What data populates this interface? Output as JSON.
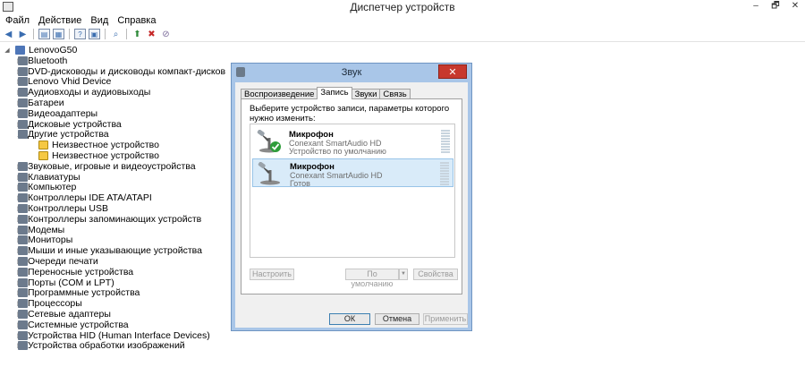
{
  "window": {
    "title": "Диспетчер устройств",
    "controls": [
      "–",
      "🗗",
      "✕"
    ]
  },
  "menu": [
    "Файл",
    "Действие",
    "Вид",
    "Справка"
  ],
  "toolbar_icons": [
    "back-icon",
    "forward-icon",
    "properties-icon",
    "help-icon",
    "scan-hardware-icon",
    "update-driver-icon",
    "uninstall-icon",
    "disable-icon"
  ],
  "tree": {
    "root": "LenovoG50",
    "items": [
      {
        "label": "Bluetooth",
        "level": 1,
        "expander": "▷"
      },
      {
        "label": "DVD-дисководы и дисководы компакт-дисков",
        "level": 1,
        "expander": "▷"
      },
      {
        "label": "Lenovo Vhid Device",
        "level": 1,
        "expander": "▷"
      },
      {
        "label": "Аудиовходы и аудиовыходы",
        "level": 1,
        "expander": "▷"
      },
      {
        "label": "Батареи",
        "level": 1,
        "expander": "▷"
      },
      {
        "label": "Видеоадаптеры",
        "level": 1,
        "expander": "▷"
      },
      {
        "label": "Дисковые устройства",
        "level": 1,
        "expander": "▷"
      },
      {
        "label": "Другие устройства",
        "level": 1,
        "expander": "◢"
      },
      {
        "label": "Неизвестное устройство",
        "level": 2,
        "expander": ""
      },
      {
        "label": "Неизвестное устройство",
        "level": 2,
        "expander": ""
      },
      {
        "label": "Звуковые, игровые и видеоустройства",
        "level": 1,
        "expander": "▷"
      },
      {
        "label": "Клавиатуры",
        "level": 1,
        "expander": "▷"
      },
      {
        "label": "Компьютер",
        "level": 1,
        "expander": "▷"
      },
      {
        "label": "Контроллеры IDE ATA/ATAPI",
        "level": 1,
        "expander": "▷"
      },
      {
        "label": "Контроллеры USB",
        "level": 1,
        "expander": "▷"
      },
      {
        "label": "Контроллеры запоминающих устройств",
        "level": 1,
        "expander": "▷"
      },
      {
        "label": "Модемы",
        "level": 1,
        "expander": "▷"
      },
      {
        "label": "Мониторы",
        "level": 1,
        "expander": "▷"
      },
      {
        "label": "Мыши и иные указывающие устройства",
        "level": 1,
        "expander": "▷"
      },
      {
        "label": "Очереди печати",
        "level": 1,
        "expander": "▷"
      },
      {
        "label": "Переносные устройства",
        "level": 1,
        "expander": "▷"
      },
      {
        "label": "Порты (COM и LPT)",
        "level": 1,
        "expander": "▷"
      },
      {
        "label": "Программные устройства",
        "level": 1,
        "expander": "▷"
      },
      {
        "label": "Процессоры",
        "level": 1,
        "expander": "▷"
      },
      {
        "label": "Сетевые адаптеры",
        "level": 1,
        "expander": "▷"
      },
      {
        "label": "Системные устройства",
        "level": 1,
        "expander": "▷"
      },
      {
        "label": "Устройства HID (Human Interface Devices)",
        "level": 1,
        "expander": "▷"
      },
      {
        "label": "Устройства обработки изображений",
        "level": 1,
        "expander": "▷"
      }
    ]
  },
  "dialog": {
    "title": "Звук",
    "close": "✕",
    "tabs": [
      "Воспроизведение",
      "Запись",
      "Звуки",
      "Связь"
    ],
    "active_tab": "Запись",
    "instruction": "Выберите устройство записи, параметры которого нужно изменить:",
    "devices": [
      {
        "name": "Микрофон",
        "driver": "Conexant SmartAudio HD",
        "status": "Устройство по умолчанию",
        "is_default": true,
        "selected": false
      },
      {
        "name": "Микрофон",
        "driver": "Conexant SmartAudio HD",
        "status": "Готов",
        "is_default": false,
        "selected": true
      }
    ],
    "configure": "Настроить",
    "set_default": "По умолчанию",
    "properties": "Свойства",
    "ok": "ОК",
    "cancel": "Отмена",
    "apply": "Применить"
  }
}
